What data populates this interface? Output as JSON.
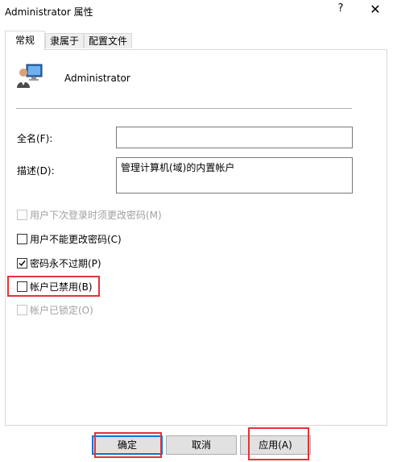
{
  "window": {
    "title": "Administrator 属性",
    "help_label": "?",
    "close_label": "✕"
  },
  "tabs": [
    {
      "label": "常规",
      "active": true
    },
    {
      "label": "隶属于",
      "active": false
    },
    {
      "label": "配置文件",
      "active": false
    }
  ],
  "user": {
    "name": "Administrator",
    "icon": "user-computer-icon"
  },
  "fields": {
    "fullname": {
      "label": "全名(F):",
      "value": ""
    },
    "description": {
      "label": "描述(D):",
      "value": "管理计算机(域)的内置帐户"
    }
  },
  "checkboxes": [
    {
      "label": "用户下次登录时须更改密码(M)",
      "checked": false,
      "disabled": true
    },
    {
      "label": "用户不能更改密码(C)",
      "checked": false,
      "disabled": false
    },
    {
      "label": "密码永不过期(P)",
      "checked": true,
      "disabled": false
    },
    {
      "label": "帐户已禁用(B)",
      "checked": false,
      "disabled": false
    },
    {
      "label": "帐户已锁定(O)",
      "checked": false,
      "disabled": true
    }
  ],
  "buttons": {
    "ok": "确定",
    "cancel": "取消",
    "apply": "应用(A)"
  },
  "colors": {
    "highlight": "#e0343a",
    "accent": "#0078d7"
  }
}
